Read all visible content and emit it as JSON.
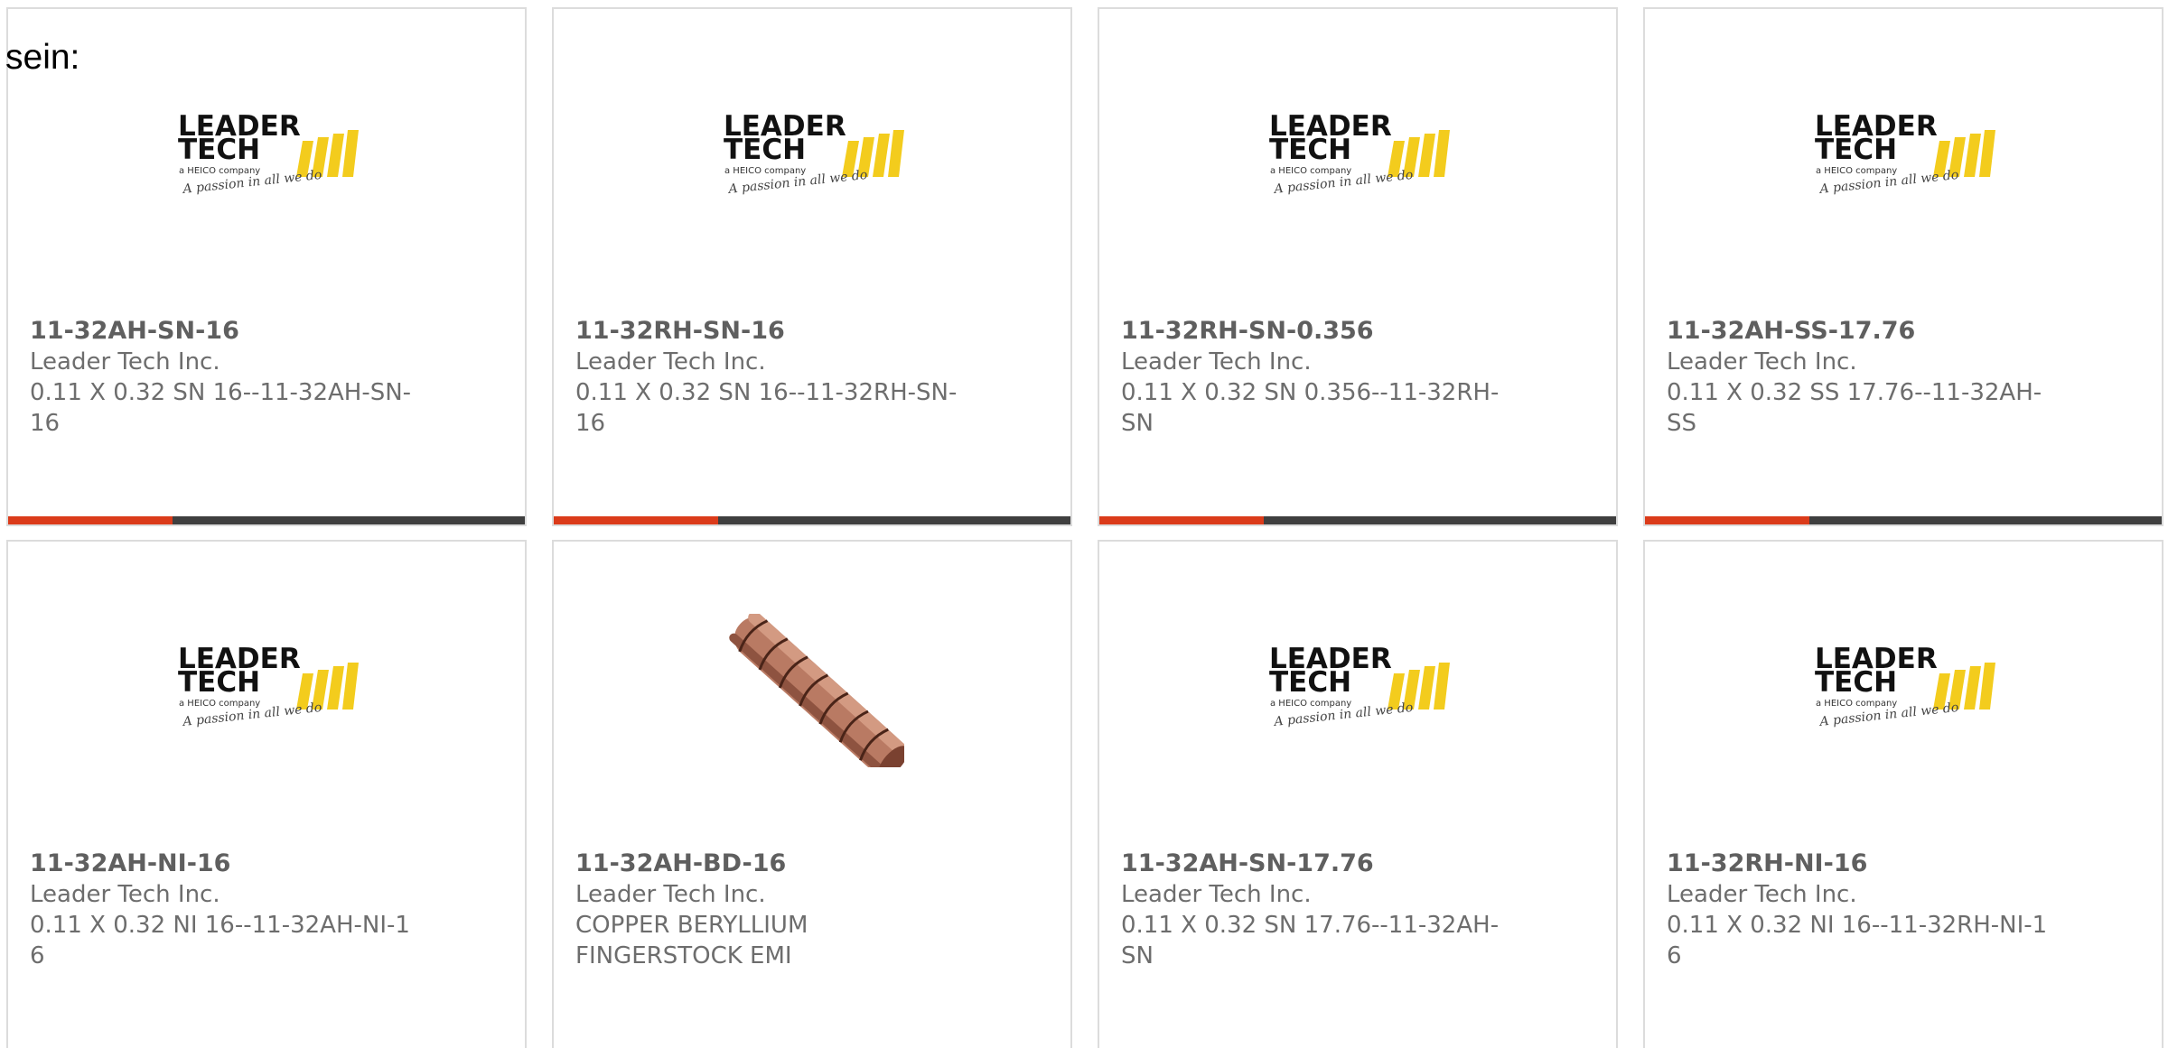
{
  "intro": {
    "text": "sein:"
  },
  "colors": {
    "accent": "#db3b1a",
    "bar": "#3f3f3f",
    "logo_yellow": "#f3cc1d",
    "text_gray": "#6d6d6d"
  },
  "logo": {
    "line1": "LEADER",
    "line2": "TECH",
    "company": "a HEICO company",
    "tagline": "A passion in all we do"
  },
  "products": [
    {
      "part_number": "11-32AH-SN-16",
      "manufacturer": "Leader Tech Inc.",
      "description": "0.11 X 0.32 SN 16--11-32AH-SN-16",
      "image": "leader-tech-logo"
    },
    {
      "part_number": "11-32RH-SN-16",
      "manufacturer": "Leader Tech Inc.",
      "description": "0.11 X 0.32 SN 16--11-32RH-SN-16",
      "image": "leader-tech-logo"
    },
    {
      "part_number": "11-32RH-SN-0.356",
      "manufacturer": "Leader Tech Inc.",
      "description": "0.11 X 0.32 SN 0.356--11-32RH-SN",
      "image": "leader-tech-logo"
    },
    {
      "part_number": "11-32AH-SS-17.76",
      "manufacturer": "Leader Tech Inc.",
      "description": "0.11 X 0.32 SS 17.76--11-32AH-SS",
      "image": "leader-tech-logo"
    },
    {
      "part_number": "11-32AH-NI-16",
      "manufacturer": "Leader Tech Inc.",
      "description": "0.11 X 0.32 NI 16--11-32AH-NI-16",
      "image": "leader-tech-logo"
    },
    {
      "part_number": "11-32AH-BD-16",
      "manufacturer": "Leader Tech Inc.",
      "description": "COPPER BERYLLIUM FINGERSTOCK EMI",
      "image": "fingerstock-product-photo"
    },
    {
      "part_number": "11-32AH-SN-17.76",
      "manufacturer": "Leader Tech Inc.",
      "description": "0.11 X 0.32 SN 17.76--11-32AH-SN",
      "image": "leader-tech-logo"
    },
    {
      "part_number": "11-32RH-NI-16",
      "manufacturer": "Leader Tech Inc.",
      "description": "0.11 X 0.32 NI 16--11-32RH-NI-16",
      "image": "leader-tech-logo"
    }
  ]
}
